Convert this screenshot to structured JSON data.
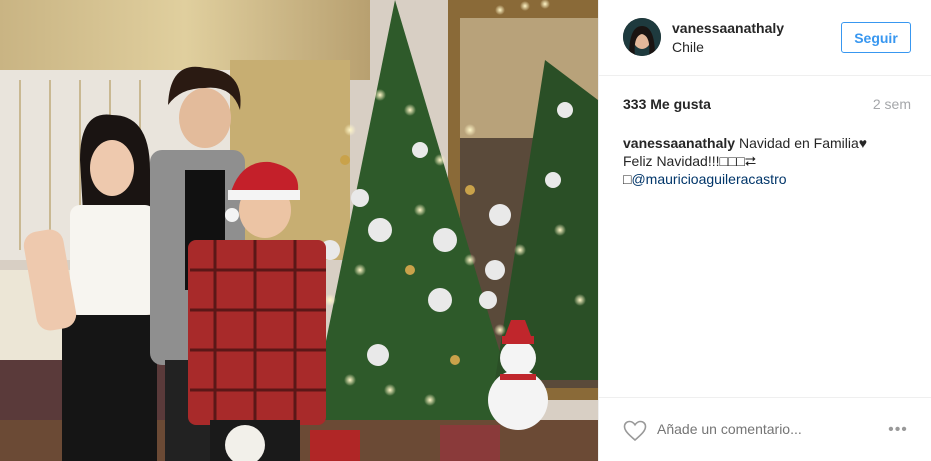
{
  "post": {
    "username": "vanessaanathaly",
    "location": "Chile",
    "follow_label": "Seguir",
    "likes": "333 Me gusta",
    "time": "2 sem",
    "caption_user": "vanessaanathaly",
    "caption_line1": "Navidad en Familia♥",
    "caption_line2": "Feliz Navidad!!!□□□⮂",
    "caption_line3_prefix": "□",
    "mention": "@mauricioaguileracastro",
    "comment_placeholder": "Añade un comentario...",
    "more_label": "•••"
  },
  "colors": {
    "accent": "#3897f0",
    "mention": "#003569",
    "muted": "#a5a7aa",
    "border": "#efefef"
  },
  "icons": {
    "like": "heart-outline-icon",
    "more": "more-options-icon"
  }
}
